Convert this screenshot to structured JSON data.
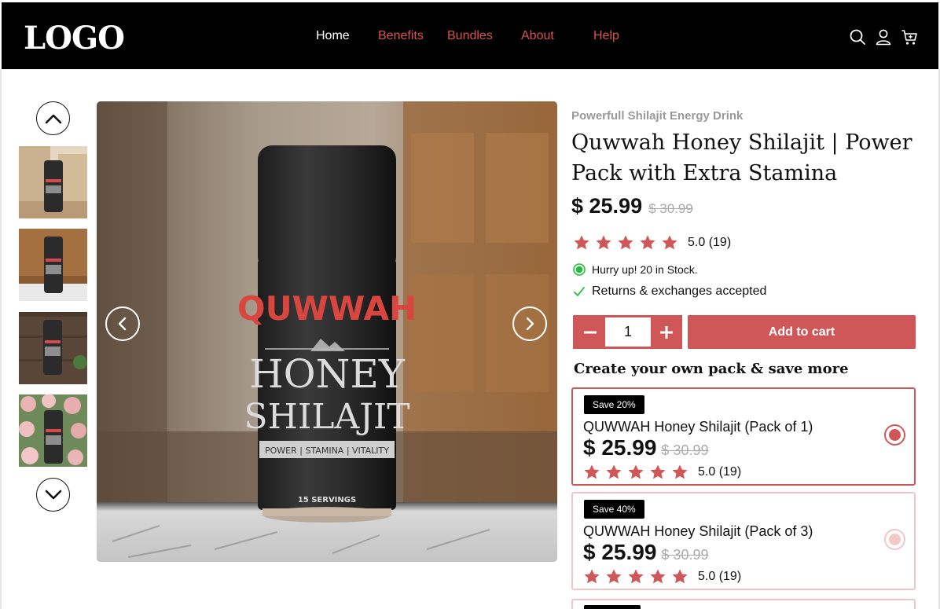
{
  "header": {
    "logo": "LOGO",
    "nav": [
      {
        "label": "Home",
        "active": true
      },
      {
        "label": "Benefits",
        "active": false
      },
      {
        "label": "Bundles",
        "active": false
      },
      {
        "label": "About",
        "active": false
      },
      {
        "label": "Help",
        "active": false
      }
    ],
    "icons": [
      "search-icon",
      "user-icon",
      "cart-icon"
    ]
  },
  "gallery": {
    "thumbnails": [
      "thumbnail-stone",
      "thumbnail-marble",
      "thumbnail-wood",
      "thumbnail-roses"
    ],
    "product_brand": "QUWWAH",
    "product_line1": "HONEY",
    "product_line2": "SHILAJIT",
    "product_tagline": "POWER | STAMINA | VITALITY",
    "product_servings": "15 SERVINGS"
  },
  "product": {
    "subtitle": "Powerfull Shilajit Energy Drink",
    "title": "Quwwah Honey Shilajit | Power Pack with Extra Stamina",
    "price": "$ 25.99",
    "old_price": "$ 30.99",
    "rating": "5.0 (19)",
    "stars": 5,
    "stock_text": "Hurry up! 20 in Stock.",
    "returns_text": "Returns & exchanges accepted",
    "quantity": "1",
    "add_to_cart": "Add to cart"
  },
  "packs": {
    "heading": "Create your own pack & save more",
    "items": [
      {
        "badge": "Save 20%",
        "name": "QUWWAH Honey Shilajit (Pack of 1)",
        "price": "$ 25.99",
        "old_price": "$ 30.99",
        "rating": "5.0 (19)",
        "selected": true
      },
      {
        "badge": "Save 40%",
        "name": "QUWWAH Honey Shilajit (Pack of 3)",
        "price": "$ 25.99",
        "old_price": "$ 30.99",
        "rating": "5.0 (19)",
        "selected": false
      }
    ]
  },
  "colors": {
    "accent": "#d05757",
    "header_bg": "#000000",
    "stock_green": "#1fbf3a"
  }
}
